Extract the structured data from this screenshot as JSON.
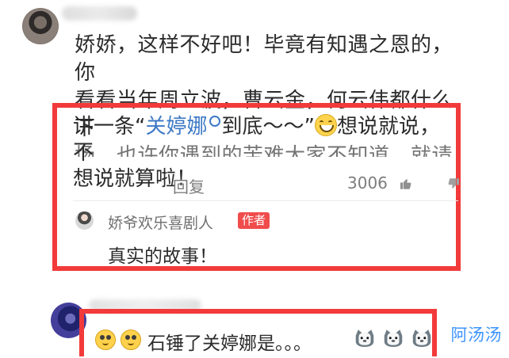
{
  "comment": {
    "line1": "娇娇，这样不好吧！毕竟有知遇之恩的，你",
    "line2": "看看当年周立波，曹云金，何云伟都什么下",
    "line3": "场，也许你遇到的苦难大家不知道，就请你",
    "highlight_prefix": "讲一条“",
    "mention": "关婷娜",
    "highlight_middle": "到底～～”",
    "highlight_suffix": "想说就说，不",
    "line5": "想说就算啦！"
  },
  "actions": {
    "reply_label": "回复",
    "like_count": "3006"
  },
  "author_reply": {
    "name": "娇爷欢乐喜剧人",
    "badge": "作者",
    "text": "真实的故事！"
  },
  "second_comment": {
    "text": "石锤了关婷娜是。。。"
  },
  "watermark": {
    "text": "阿汤汤"
  },
  "icons": {
    "avatar": "avatar",
    "search": "search-icon",
    "grin": "grin-icon",
    "like": "thumbs-up-icon",
    "dislike": "thumbs-down-icon",
    "cat": "cat-icon",
    "think": "thinking-face-icon"
  },
  "colors": {
    "highlight_red": "#f23a3a",
    "mention_blue": "#3d79c5",
    "watermark_blue": "#2d8cff"
  }
}
